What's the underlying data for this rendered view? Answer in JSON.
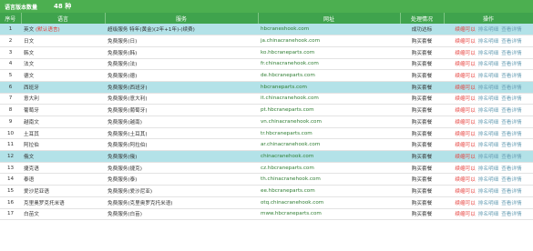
{
  "header": {
    "title": "语言版本数量",
    "count": "48 种"
  },
  "columns": [
    "序号",
    "语言",
    "服务",
    "网址",
    "处理情况",
    "操作"
  ],
  "rows": [
    {
      "no": "1",
      "lang": "英文",
      "tag": "(默认语言)",
      "service": "超级服务 特年(黄金)(2年+1年)-(续费)",
      "site": "hbcraneshook.com",
      "status": "成功达标",
      "op1": "续缩可以",
      "op2": "排名明细",
      "op3": "查看详情",
      "hl": true
    },
    {
      "no": "2",
      "lang": "日文",
      "tag": "",
      "service": "免费服务(日)",
      "site": "ja.chinacranehook.com",
      "status": "购买套餐",
      "op1": "续缩可以",
      "op2": "排名明细",
      "op3": "查看详情",
      "hl": false
    },
    {
      "no": "3",
      "lang": "韩文",
      "tag": "",
      "service": "免费服务(韩)",
      "site": "ko.hbcraneparts.com",
      "status": "购买套餐",
      "op1": "续缩可以",
      "op2": "排名明细",
      "op3": "查看详情",
      "hl": false
    },
    {
      "no": "4",
      "lang": "法文",
      "tag": "",
      "service": "免费服务(法)",
      "site": "fr.chinacranehook.com",
      "status": "购买套餐",
      "op1": "续缩可以",
      "op2": "排名明细",
      "op3": "查看详情",
      "hl": false
    },
    {
      "no": "5",
      "lang": "德文",
      "tag": "",
      "service": "免费服务(德)",
      "site": "de.hbcraneparts.com",
      "status": "购买套餐",
      "op1": "续缩可以",
      "op2": "排名明细",
      "op3": "查看详情",
      "hl": false
    },
    {
      "no": "6",
      "lang": "西班牙",
      "tag": "",
      "service": "免费服务(西班牙)",
      "site": "hbcraneparts.com",
      "status": "购买套餐",
      "op1": "续缩可以",
      "op2": "排名明细",
      "op3": "查看详情",
      "hl": true
    },
    {
      "no": "7",
      "lang": "意大利",
      "tag": "",
      "service": "免费服务(意大利)",
      "site": "it.chinacranehook.com",
      "status": "购买套餐",
      "op1": "续缩可以",
      "op2": "排名明细",
      "op3": "查看详情",
      "hl": false
    },
    {
      "no": "8",
      "lang": "葡萄牙",
      "tag": "",
      "service": "免费服务(葡萄牙)",
      "site": "pt.hbcraneparts.com",
      "status": "购买套餐",
      "op1": "续缩可以",
      "op2": "排名明细",
      "op3": "查看详情",
      "hl": false
    },
    {
      "no": "9",
      "lang": "越南文",
      "tag": "",
      "service": "免费服务(越南)",
      "site": "vn.chinacranehook.com",
      "status": "购买套餐",
      "op1": "续缩可以",
      "op2": "排名明细",
      "op3": "查看详情",
      "hl": false
    },
    {
      "no": "10",
      "lang": "土耳其",
      "tag": "",
      "service": "免费服务(土耳其)",
      "site": "tr.hbcraneparts.com",
      "status": "购买套餐",
      "op1": "续缩可以",
      "op2": "排名明细",
      "op3": "查看详情",
      "hl": false
    },
    {
      "no": "11",
      "lang": "阿拉伯",
      "tag": "",
      "service": "免费服务(阿拉伯)",
      "site": "ar.chinacranehook.com",
      "status": "购买套餐",
      "op1": "续缩可以",
      "op2": "排名明细",
      "op3": "查看详情",
      "hl": false
    },
    {
      "no": "12",
      "lang": "俄文",
      "tag": "",
      "service": "免费服务(俄)",
      "site": "chinacranehook.com",
      "status": "购买套餐",
      "op1": "续缩可以",
      "op2": "排名明细",
      "op3": "查看详情",
      "hl": true
    },
    {
      "no": "13",
      "lang": "捷克语",
      "tag": "",
      "service": "免费服务(捷克)",
      "site": "cz.hbcraneparts.com",
      "status": "购买套餐",
      "op1": "续缩可以",
      "op2": "排名明细",
      "op3": "查看详情",
      "hl": false
    },
    {
      "no": "14",
      "lang": "泰语",
      "tag": "",
      "service": "免费服务(泰)",
      "site": "th.chinacranehook.com",
      "status": "购买套餐",
      "op1": "续缩可以",
      "op2": "排名明细",
      "op3": "查看详情",
      "hl": false
    },
    {
      "no": "15",
      "lang": "爱沙尼亚语",
      "tag": "",
      "service": "免费服务(爱沙尼亚)",
      "site": "ee.hbcraneparts.com",
      "status": "购买套餐",
      "op1": "续缩可以",
      "op2": "排名明细",
      "op3": "查看详情",
      "hl": false
    },
    {
      "no": "16",
      "lang": "克里奥罗克托米语",
      "tag": "",
      "service": "免费服务(克里奥罗克托米语)",
      "site": "otq.chinacranehook.com",
      "status": "购买套餐",
      "op1": "续缩可以",
      "op2": "排名明细",
      "op3": "查看详情",
      "hl": false
    },
    {
      "no": "17",
      "lang": "白苗文",
      "tag": "",
      "service": "免费服务(白苗)",
      "site": "mww.hbcraneparts.com",
      "status": "购买套餐",
      "op1": "续缩可以",
      "op2": "排名明细",
      "op3": "查看详情",
      "hl": false
    }
  ]
}
